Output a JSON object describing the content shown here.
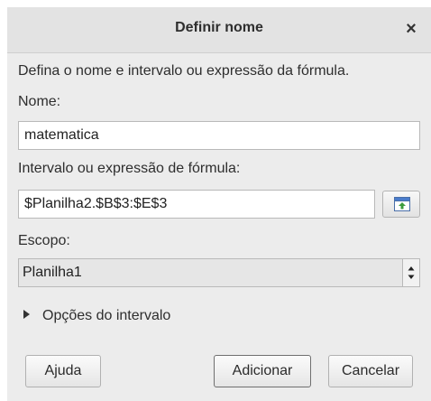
{
  "dialog": {
    "title": "Definir nome",
    "close_symbol": "×",
    "description": "Defina o nome e intervalo ou expressão da fórmula.",
    "name_label": "Nome:",
    "name_value": "matematica",
    "range_label": "Intervalo ou expressão de fórmula:",
    "range_value": "$Planilha2.$B$3:$E$3",
    "range_button_icon": "shrink-range-icon",
    "scope_label": "Escopo:",
    "scope_value": "Planilha1",
    "options_expander_label": "Opções do intervalo",
    "buttons": {
      "help": "Ajuda",
      "add": "Adicionar",
      "cancel": "Cancelar"
    }
  },
  "colors": {
    "titlebar": "#e3e3e3",
    "window_bg": "#ececec",
    "accent_mark": "#1e4fa0"
  }
}
